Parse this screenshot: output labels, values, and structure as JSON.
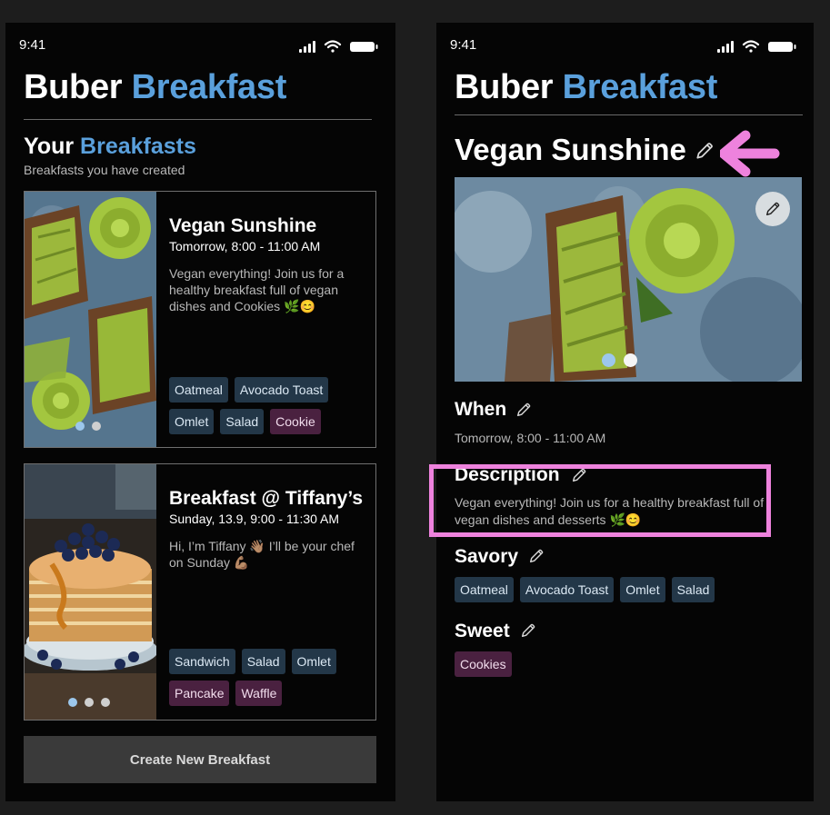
{
  "status_bar": {
    "time": "9:41"
  },
  "app": {
    "title_part1": "Buber",
    "title_part2": "Breakfast"
  },
  "list_screen": {
    "section_title_part1": "Your",
    "section_title_part2": "Breakfasts",
    "section_subtitle": "Breakfasts you have created",
    "cards": [
      {
        "title": "Vegan Sunshine",
        "time": "Tomorrow, 8:00 - 11:00 AM",
        "description": "Vegan everything! Join us for a healthy breakfast full of vegan dishes and Cookies 🌿😊",
        "savory": [
          "Oatmeal",
          "Avocado Toast",
          "Omlet",
          "Salad"
        ],
        "sweet": [
          "Cookie"
        ],
        "image_icon": "avocado-toast-photo"
      },
      {
        "title": "Breakfast @ Tiffany’s",
        "time": "Sunday, 13.9, 9:00 - 11:30 AM",
        "description": "Hi, I’m Tiffany 👋🏽 I’ll be your chef on Sunday 💪🏽",
        "savory": [
          "Sandwich",
          "Salad",
          "Omlet"
        ],
        "sweet": [
          "Pancake",
          "Waffle"
        ],
        "image_icon": "pancakes-photo"
      }
    ],
    "create_button": "Create New Breakfast"
  },
  "detail_screen": {
    "title": "Vegan Sunshine",
    "when_label": "When",
    "when_value": "Tomorrow, 8:00 - 11:00 AM",
    "description_label": "Description",
    "description_value": "Vegan everything! Join us for a healthy breakfast full of vegan dishes and desserts 🌿😊",
    "savory_label": "Savory",
    "savory": [
      "Oatmeal",
      "Avocado Toast",
      "Omlet",
      "Salad"
    ],
    "sweet_label": "Sweet",
    "sweet": [
      "Cookies"
    ]
  },
  "colors": {
    "accent": "#5aa0dc",
    "savory_tag": "#233748",
    "sweet_tag": "#4a2140",
    "annotation": "#ee82dd"
  }
}
